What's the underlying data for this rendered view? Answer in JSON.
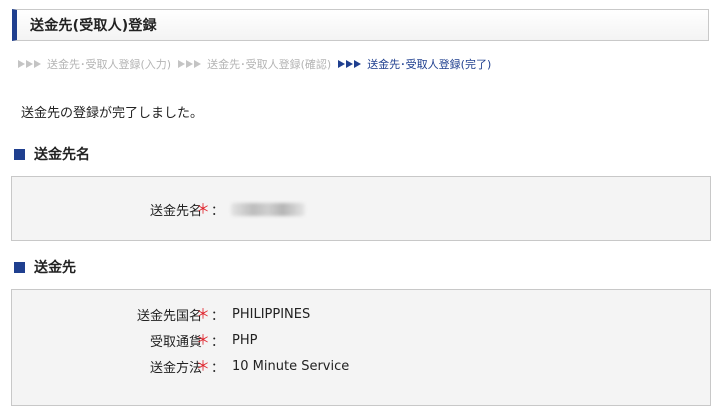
{
  "header": {
    "title": "送金先(受取人)登録"
  },
  "steps": [
    {
      "label": "送金先･受取人登録(入力)",
      "active": false
    },
    {
      "label": "送金先･受取人登録(確認)",
      "active": false
    },
    {
      "label": "送金先･受取人登録(完了)",
      "active": true
    }
  ],
  "message": "送金先の登録が完了しました。",
  "required_mark": "＊",
  "colon": "：",
  "section_name": {
    "heading": "送金先名",
    "fields": [
      {
        "label": "送金先名",
        "value": ""
      }
    ]
  },
  "section_dest": {
    "heading": "送金先",
    "fields": [
      {
        "label": "送金先国名",
        "value": "PHILIPPINES"
      },
      {
        "label": "受取通貨",
        "value": "PHP"
      },
      {
        "label": "送金方法",
        "value": "10 Minute Service"
      }
    ]
  },
  "colors": {
    "accent": "#1f3f8f",
    "required": "#e0262e",
    "inactive_step": "#b4b4b4"
  }
}
